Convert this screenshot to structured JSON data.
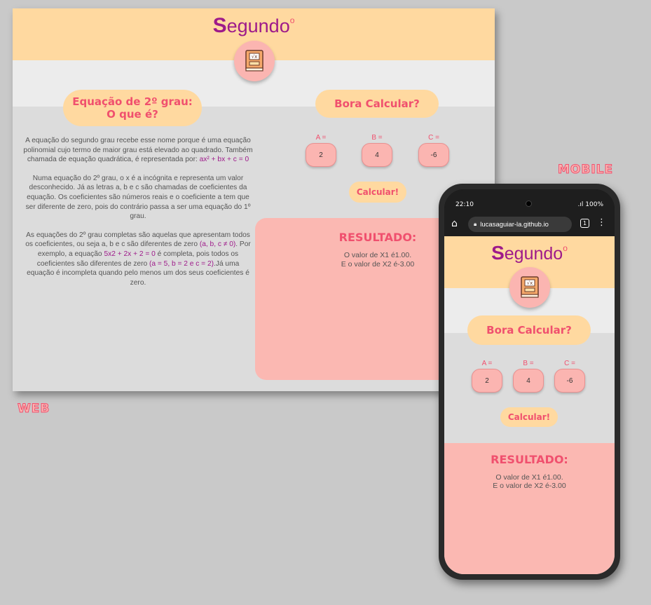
{
  "web": {
    "logo_initial": "S",
    "logo_rest": "egundo",
    "logo_mark": "o",
    "section_title_line1": "Equação de 2º grau:",
    "section_title_line2": "O que é?",
    "calc_title": "Bora Calcular?",
    "para1_a": "A equação do segundo grau recebe esse nome porque é uma equação polinomial cujo termo de maior grau está elevado ao quadrado. Também chamada de equação quadrática, é representada por: ",
    "para1_hl": "ax² + bx + c = 0",
    "para2": "Numa equação do 2º grau, o x é a incógnita e representa um valor desconhecido. Já as letras a, b e c são chamadas de coeficientes da equação. Os coeficientes são números reais e o coeficiente a tem que ser diferente de zero, pois do contrário passa a ser uma equação do 1º grau.",
    "para3_a": "As equações do 2º grau completas são aquelas que apresentam todos os coeficientes, ou seja a, b e c são diferentes de zero ",
    "para3_hl1": "(a, b, c ≠ 0)",
    "para3_b": ". Por exemplo, a equação ",
    "para3_hl2": "5x2 + 2x + 2 = 0",
    "para3_c": " é completa, pois todos os coeficientes são diferentes de zero ",
    "para3_hl3": "(a = 5, b = 2 e c = 2)",
    "para3_d": ".Já uma equação é incompleta quando pelo menos um dos seus coeficientes é zero.",
    "label_a": "A =",
    "label_b": "B =",
    "label_c": "C =",
    "value_a": "2",
    "value_b": "4",
    "value_c": "-6",
    "calc_button": "Calcular!",
    "result_title": "RESULTADO:",
    "result_line1": "O valor de X1 é1.00.",
    "result_line2": "E o valor de X2 é-3.00"
  },
  "tags": {
    "web": "WEB",
    "mobile": "MOBILE"
  },
  "phone": {
    "time": "22:10",
    "battery": ".ıl 100%",
    "url": "lucasaguiar-la.github.io",
    "tab_count": "1",
    "logo_initial": "S",
    "logo_rest": "egundo",
    "logo_mark": "o",
    "calc_title": "Bora Calcular?",
    "label_a": "A =",
    "label_b": "B =",
    "label_c": "C =",
    "value_a": "2",
    "value_b": "4",
    "value_c": "-6",
    "calc_button": "Calcular!",
    "result_title": "RESULTADO:",
    "result_line1": "O valor de X1 é1.00.",
    "result_line2": "E o valor de X2 é-3.00"
  },
  "icons": {
    "book": "math-book-icon",
    "home": "home-icon",
    "lock": "lock-icon",
    "menu": "menu-icon"
  },
  "colors": {
    "header": "#ffd9a0",
    "accent": "#f0506e",
    "logo": "#9e1a8a",
    "result_bg": "#fbb8b2",
    "page_bg": "#dcdcdc"
  }
}
